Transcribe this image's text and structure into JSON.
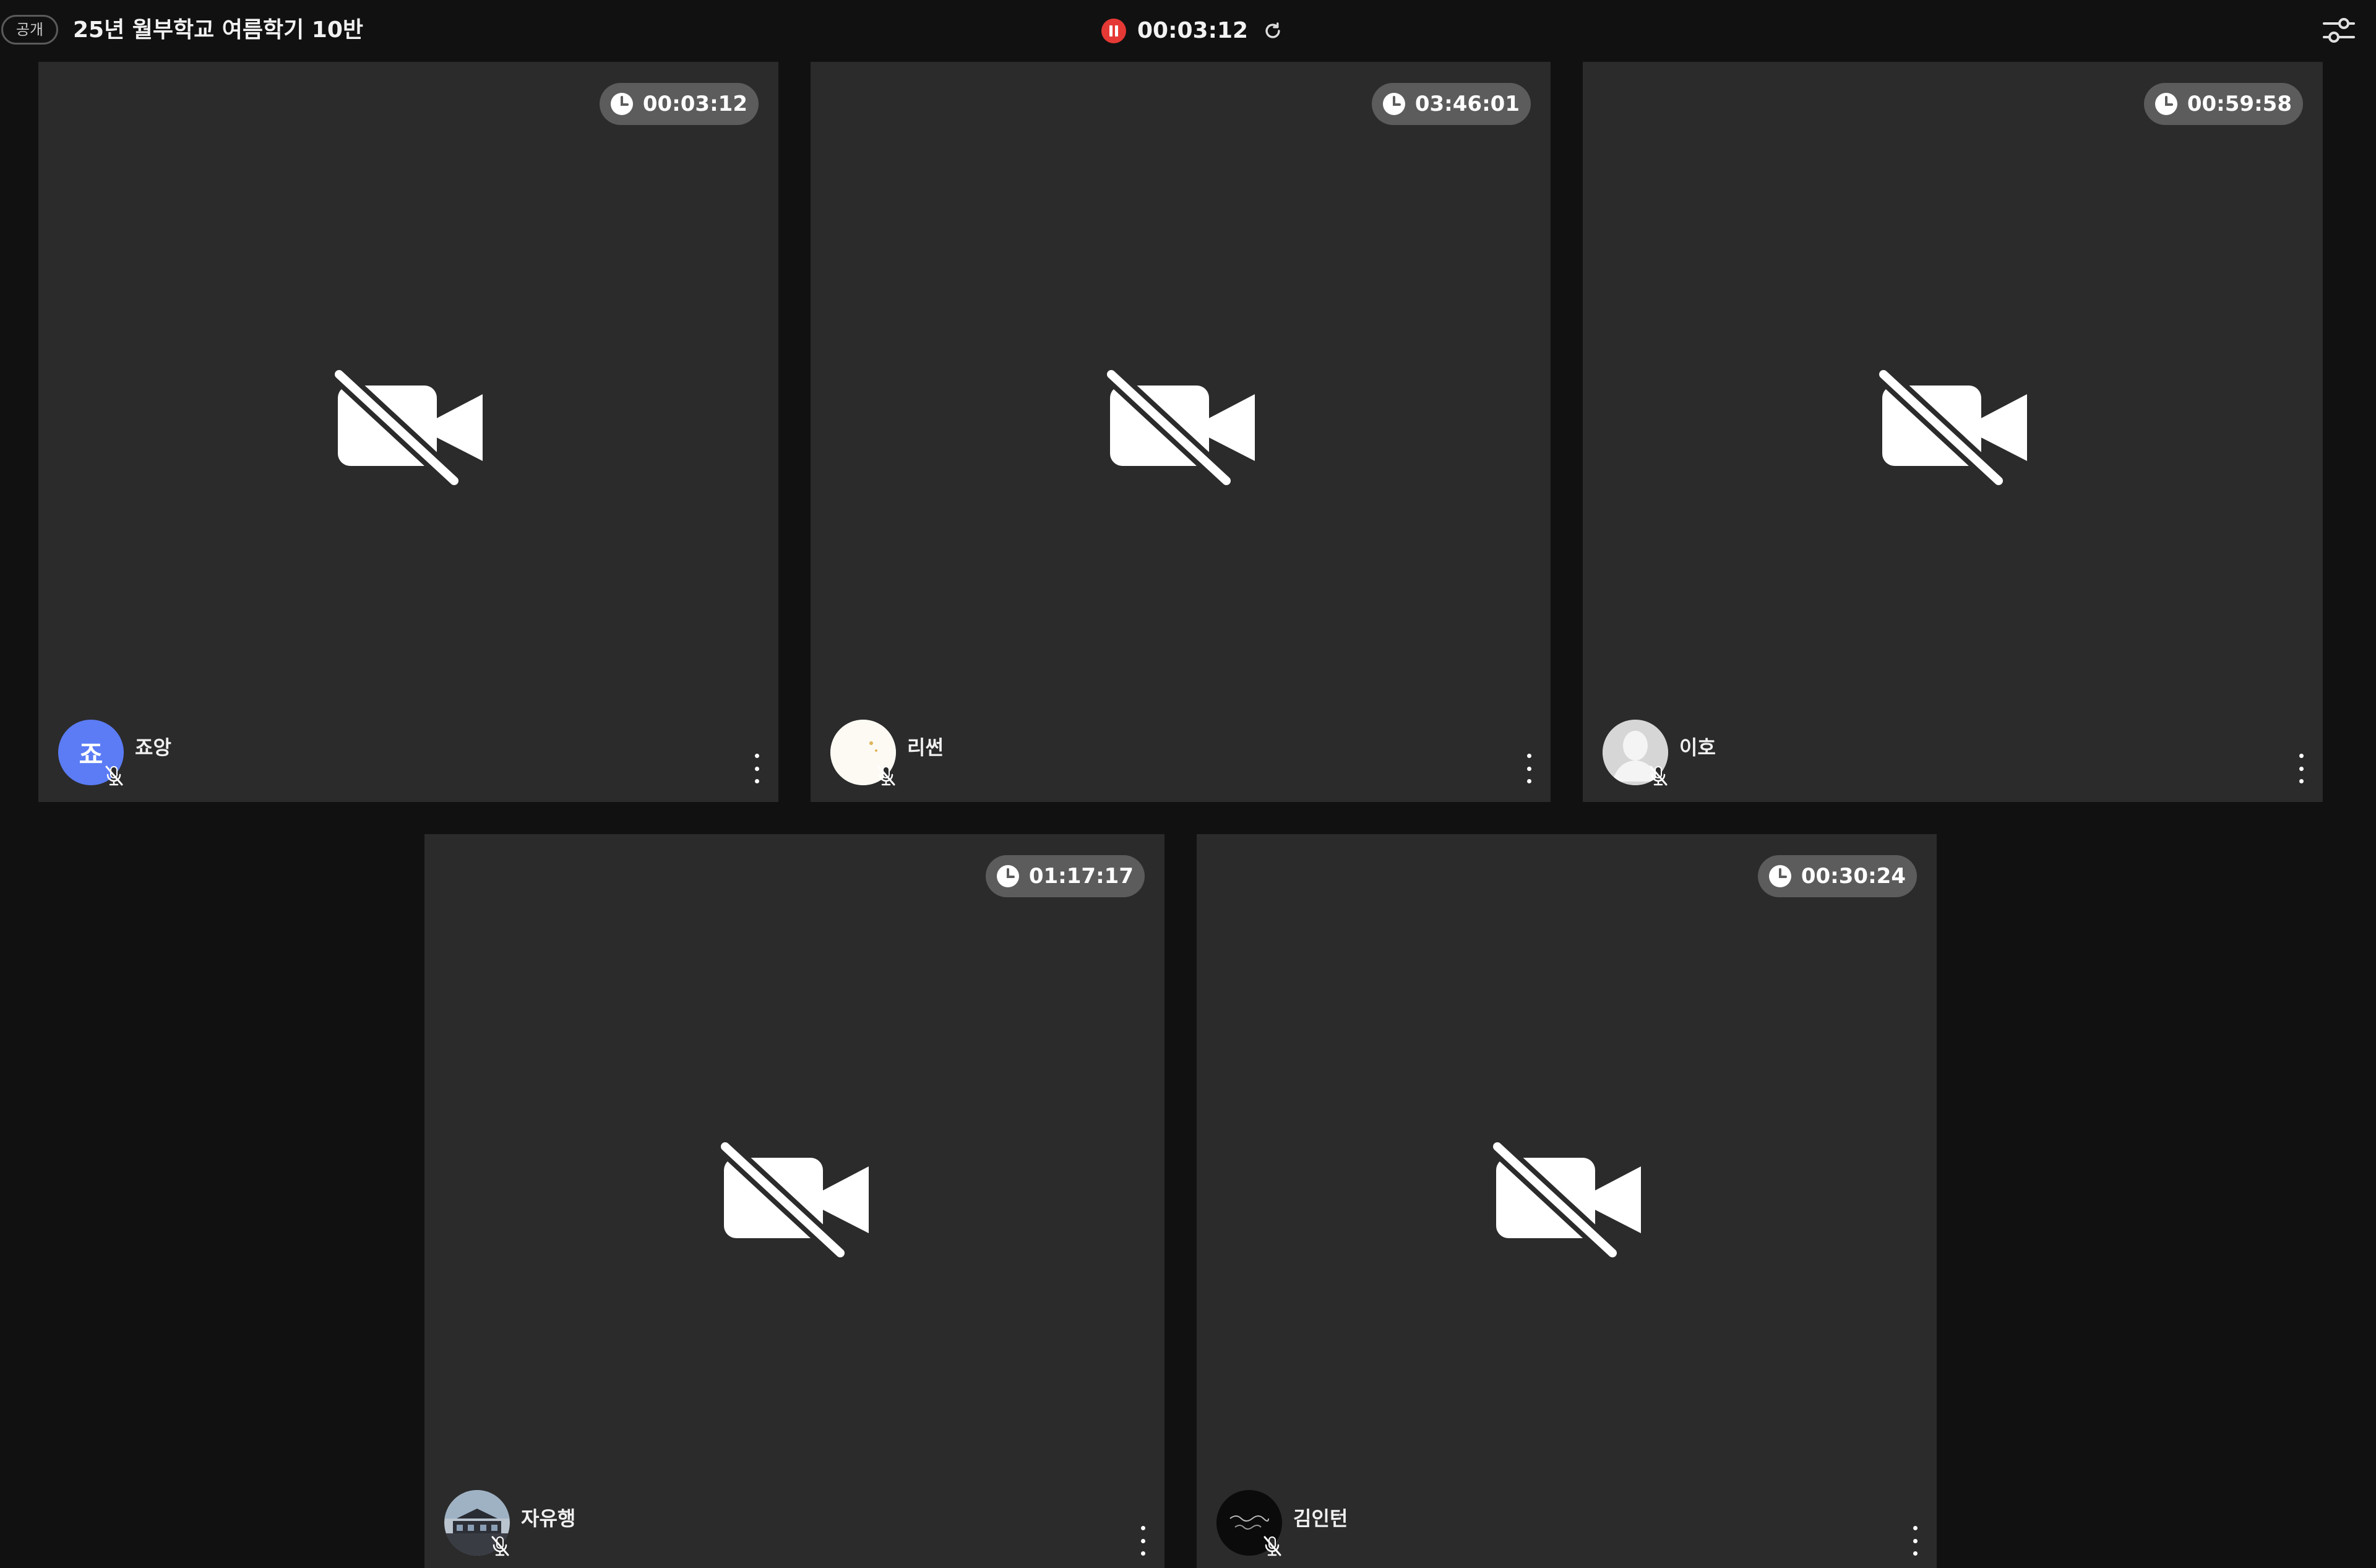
{
  "header": {
    "visibility_label": "공개",
    "room_title": "25년 월부학교 여름학기 10반",
    "recording_time": "00:03:12"
  },
  "colors": {
    "background": "#111111",
    "tile": "#2b2b2b",
    "timer_pill": "#5c5c5c",
    "recording": "#e53935"
  },
  "participants": [
    {
      "name": "죠앙",
      "timer": "00:03:12",
      "avatar_initial": "죠",
      "avatar_color": "#5b7cf5",
      "avatar_style": "initial",
      "mic": "muted",
      "camera": "off"
    },
    {
      "name": "리썬",
      "timer": "03:46:01",
      "avatar_style": "image-moon-logo",
      "mic": "muted",
      "camera": "off"
    },
    {
      "name": "이호",
      "timer": "00:59:58",
      "avatar_style": "image-default-silhouette",
      "mic": "muted",
      "camera": "off"
    },
    {
      "name": "자유행",
      "timer": "01:17:17",
      "avatar_style": "image-photo",
      "mic": "muted",
      "camera": "off"
    },
    {
      "name": "김인턴",
      "timer": "00:30:24",
      "avatar_style": "image-dark-logo",
      "mic": "muted",
      "camera": "off"
    }
  ]
}
